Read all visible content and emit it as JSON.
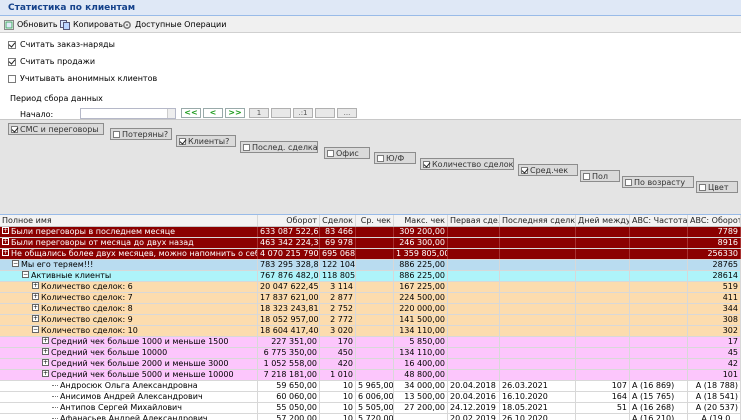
{
  "window": {
    "title": "Статистика по клиентам"
  },
  "toolbar": {
    "refresh": "Обновить",
    "copy": "Копировать",
    "ops": "Доступные Операции"
  },
  "options": [
    {
      "label": "Считать заказ-наряды",
      "checked": true
    },
    {
      "label": "Считать продажи",
      "checked": true
    },
    {
      "label": "Учитывать анонимных клиентов",
      "checked": false
    }
  ],
  "period": {
    "label": "Период сбора данных",
    "start_label": "Начало:",
    "start_value": "",
    "nav": [
      "<<",
      "<",
      ">>"
    ],
    "extra": [
      "1",
      "",
      ".:1",
      "",
      "..."
    ]
  },
  "columns_panel": [
    {
      "label": "СМС и переговоры",
      "checked": true
    },
    {
      "label": "Потеряны?",
      "checked": false
    },
    {
      "label": "Клиенты?",
      "checked": true
    },
    {
      "label": "Послед. сделка",
      "checked": false
    },
    {
      "label": "Офис",
      "checked": false
    },
    {
      "label": "Ю/Ф",
      "checked": false
    },
    {
      "label": "Количество сделок",
      "checked": true
    },
    {
      "label": "Сред.чек",
      "checked": true
    },
    {
      "label": "Пол",
      "checked": false
    },
    {
      "label": "По возрасту",
      "checked": false
    },
    {
      "label": "Цвет",
      "checked": false
    }
  ],
  "grid": {
    "headers": [
      "Полное имя",
      "Оборот",
      "Сделок",
      "Ср. чек",
      "Макс. чек",
      "Первая сде...",
      "Последняя сделка",
      "Дней между...",
      "ABC: Частота",
      "ABC: Оборот"
    ],
    "rows": [
      {
        "c": [
          "Были переговоры в последнем месяце",
          "633 087 522,68",
          "83 466",
          "",
          "309 200,00",
          "",
          "",
          "",
          "",
          "7789"
        ]
      },
      {
        "c": [
          "Были переговоры от месяца до двух назад",
          "463 342 224,34",
          "69 978",
          "",
          "246 300,00",
          "",
          "",
          "",
          "",
          "8916"
        ]
      },
      {
        "c": [
          "Не общались более двух месяцев, можно напомнить о себе",
          "4 070 215 790,31",
          "695 068",
          "",
          "1 359 805,00",
          "",
          "",
          "",
          "",
          "256330"
        ]
      },
      {
        "c": [
          "Мы его теряем!!!",
          "783 295 328,89",
          "122 104",
          "",
          "886 225,00",
          "",
          "",
          "",
          "",
          "28765"
        ]
      },
      {
        "c": [
          "Активные клиенты",
          "767 876 482,07",
          "118 805",
          "",
          "886 225,00",
          "",
          "",
          "",
          "",
          "28614"
        ]
      },
      {
        "c": [
          "Количество сделок: 6",
          "20 047 622,45",
          "3 114",
          "",
          "167 225,00",
          "",
          "",
          "",
          "",
          "519"
        ]
      },
      {
        "c": [
          "Количество сделок: 7",
          "17 837 621,00",
          "2 877",
          "",
          "224 500,00",
          "",
          "",
          "",
          "",
          "411"
        ]
      },
      {
        "c": [
          "Количество сделок: 8",
          "18 323 243,81",
          "2 752",
          "",
          "220 000,00",
          "",
          "",
          "",
          "",
          "344"
        ]
      },
      {
        "c": [
          "Количество сделок: 9",
          "18 052 957,00",
          "2 772",
          "",
          "141 500,00",
          "",
          "",
          "",
          "",
          "308"
        ]
      },
      {
        "c": [
          "Количество сделок: 10",
          "18 604 417,40",
          "3 020",
          "",
          "134 110,00",
          "",
          "",
          "",
          "",
          "302"
        ]
      },
      {
        "c": [
          "Средний чек больше 1000 и меньше 1500",
          "227 351,00",
          "170",
          "",
          "5 850,00",
          "",
          "",
          "",
          "",
          "17"
        ]
      },
      {
        "c": [
          "Средний чек больше 10000",
          "6 775 350,00",
          "450",
          "",
          "134 110,00",
          "",
          "",
          "",
          "",
          "45"
        ]
      },
      {
        "c": [
          "Средний чек больше 2000 и меньше 3000",
          "1 052 558,00",
          "420",
          "",
          "16 400,00",
          "",
          "",
          "",
          "",
          "42"
        ]
      },
      {
        "c": [
          "Средний чек больше 5000 и меньше 10000",
          "7 218 181,00",
          "1 010",
          "",
          "48 800,00",
          "",
          "",
          "",
          "",
          "101"
        ]
      },
      {
        "c": [
          "Андросюк Ольга Александровна",
          "59 650,00",
          "10",
          "5 965,00",
          "34 000,00",
          "20.04.2018",
          "26.03.2021",
          "107",
          "A (16 869)",
          "A (18 788)"
        ]
      },
      {
        "c": [
          "Анисимов Андрей Александрович",
          "60 060,00",
          "10",
          "6 006,00",
          "13 500,00",
          "20.04.2016",
          "16.10.2020",
          "164",
          "A (15 765)",
          "A (18 541)"
        ]
      },
      {
        "c": [
          "Антипов Сергей Михайлович",
          "55 050,00",
          "10",
          "5 505,00",
          "27 200,00",
          "24.12.2019",
          "18.05.2021",
          "51",
          "A (16 268)",
          "A (20 537)"
        ]
      },
      {
        "c": [
          "Афанасьев Андрей Александрович",
          "57 200,00",
          "10",
          "5 720,00",
          "",
          "20.02.2019",
          "26.10.2020",
          "",
          "A (16 210)",
          "A (19 0..."
        ]
      }
    ]
  }
}
